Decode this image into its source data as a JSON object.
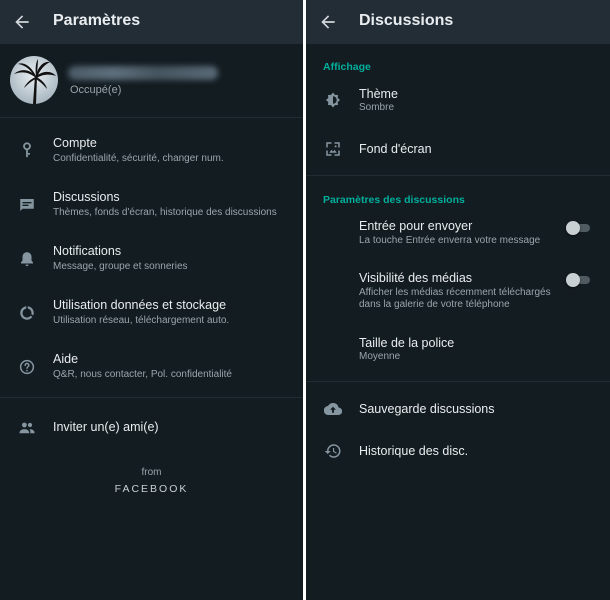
{
  "left": {
    "header": {
      "title": "Paramètres"
    },
    "profile": {
      "status": "Occupé(e)"
    },
    "menu": [
      {
        "label": "Compte",
        "sub": "Confidentialité, sécurité, changer num.",
        "icon": "key-icon"
      },
      {
        "label": "Discussions",
        "sub": "Thèmes, fonds d'écran, historique des discussions",
        "icon": "chat-icon"
      },
      {
        "label": "Notifications",
        "sub": "Message, groupe et sonneries",
        "icon": "bell-icon"
      },
      {
        "label": "Utilisation données et stockage",
        "sub": "Utilisation réseau, téléchargement auto.",
        "icon": "data-usage-icon"
      },
      {
        "label": "Aide",
        "sub": "Q&R, nous contacter, Pol. confidentialité",
        "icon": "help-icon"
      }
    ],
    "invite": {
      "label": "Inviter un(e) ami(e)",
      "icon": "people-icon"
    },
    "footer": {
      "from": "from",
      "brand": "FACEBOOK"
    }
  },
  "right": {
    "header": {
      "title": "Discussions"
    },
    "display": {
      "heading": "Affichage",
      "theme_label": "Thème",
      "theme_value": "Sombre",
      "wallpaper_label": "Fond d'écran"
    },
    "settings": {
      "heading": "Paramètres des discussions",
      "enter_label": "Entrée pour envoyer",
      "enter_sub": "La touche Entrée enverra votre message",
      "enter_on": false,
      "media_label": "Visibilité des médias",
      "media_sub": "Afficher les médias récemment téléchargés dans la galerie de votre téléphone",
      "media_on": false,
      "font_label": "Taille de la police",
      "font_value": "Moyenne"
    },
    "backup_label": "Sauvegarde discussions",
    "history_label": "Historique des disc."
  },
  "colors": {
    "background": "#131c21",
    "header": "#232d36",
    "accent": "#00af9c",
    "text": "#e9edef",
    "subtext": "#9aa4ab",
    "icon": "#8696a0"
  }
}
